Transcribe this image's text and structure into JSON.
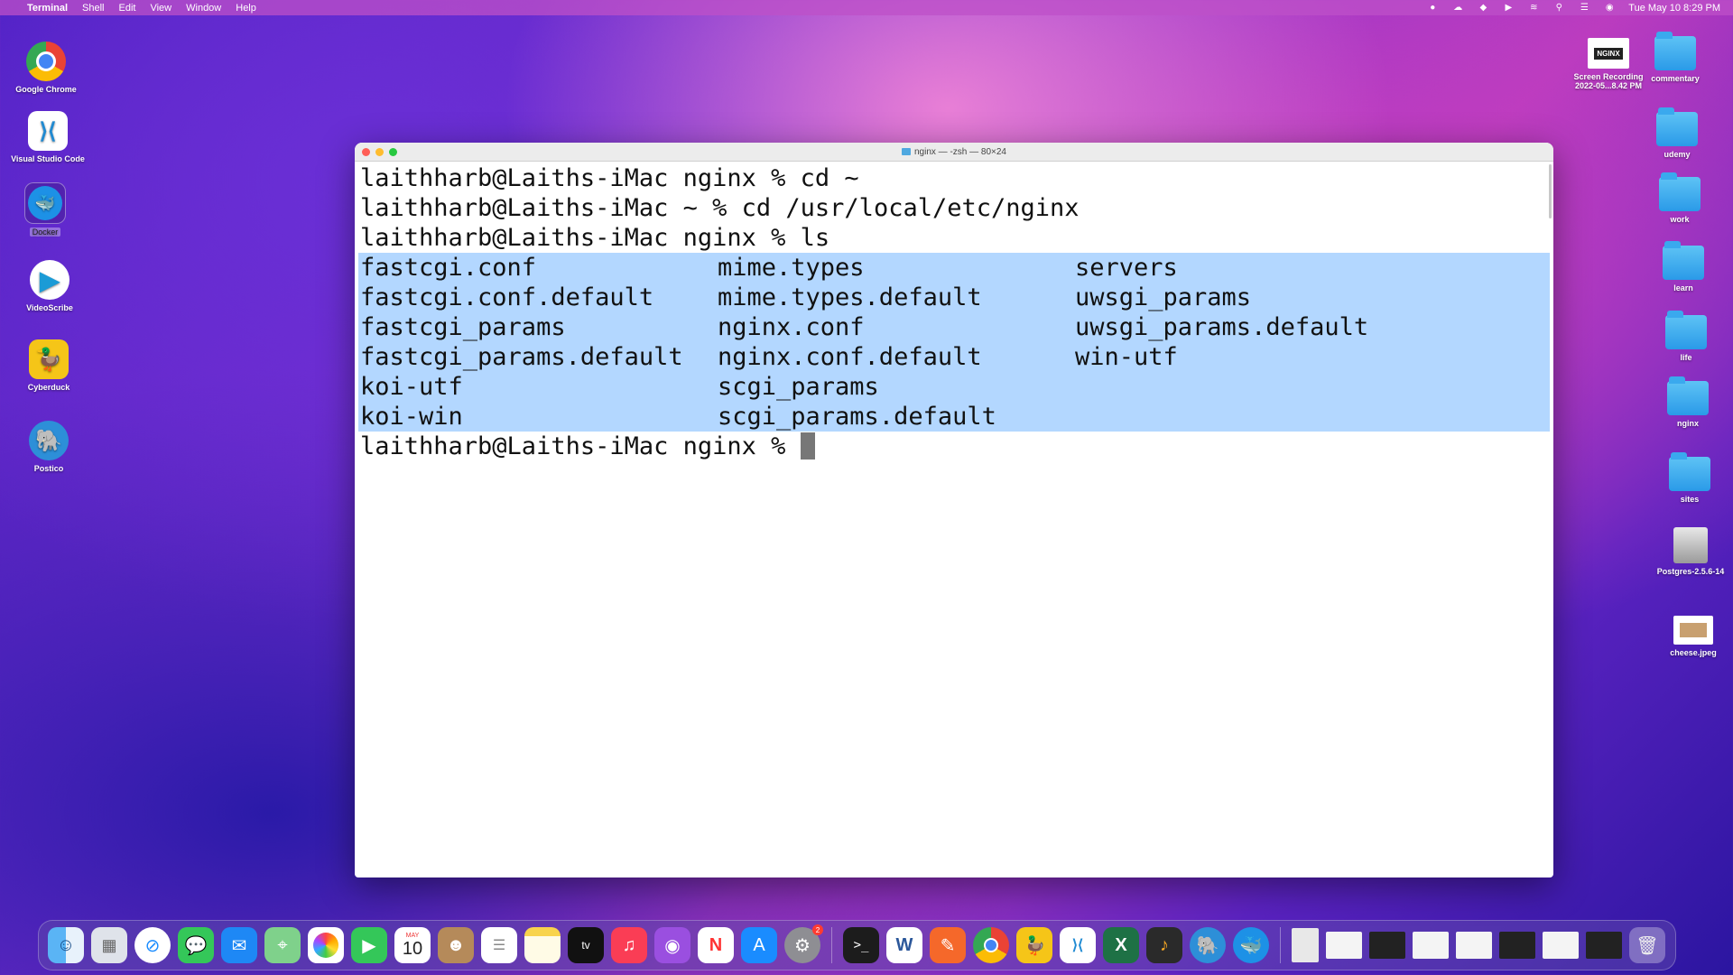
{
  "menubar": {
    "apple": "",
    "items": [
      "Terminal",
      "Shell",
      "Edit",
      "View",
      "Window",
      "Help"
    ],
    "datetime": "Tue May 10  8:29 PM"
  },
  "desktop_left": [
    {
      "label": "Google Chrome",
      "icon": "chrome-icon"
    },
    {
      "label": "Visual Studio Code",
      "icon": "vscode-icon"
    },
    {
      "label": "Docker",
      "icon": "docker-icon"
    },
    {
      "label": "VideoScribe",
      "icon": "videoscribe-icon"
    },
    {
      "label": "Cyberduck",
      "icon": "cyberduck-icon"
    },
    {
      "label": "Postico",
      "icon": "postico-icon"
    }
  ],
  "desktop_right": [
    {
      "label": "Screen Recording 2022-05...8.42 PM",
      "thumb_text": "NGINX"
    },
    {
      "label": "commentary"
    },
    {
      "label": "udemy"
    },
    {
      "label": "work"
    },
    {
      "label": "learn"
    },
    {
      "label": "life"
    },
    {
      "label": "nginx"
    },
    {
      "label": "sites"
    },
    {
      "label": "Postgres-2.5.6-14"
    },
    {
      "label": "cheese.jpeg"
    }
  ],
  "terminal": {
    "title": "nginx — -zsh — 80×24",
    "commands": [
      "laithharb@Laiths-iMac nginx % cd ~",
      "laithharb@Laiths-iMac ~ % cd /usr/local/etc/nginx",
      "laithharb@Laiths-iMac nginx % ls"
    ],
    "listing": [
      [
        "fastcgi.conf",
        "mime.types",
        "servers"
      ],
      [
        "fastcgi.conf.default",
        "mime.types.default",
        "uwsgi_params"
      ],
      [
        "fastcgi_params",
        "nginx.conf",
        "uwsgi_params.default"
      ],
      [
        "fastcgi_params.default",
        "nginx.conf.default",
        "win-utf"
      ],
      [
        "koi-utf",
        "scgi_params",
        ""
      ],
      [
        "koi-win",
        "scgi_params.default",
        ""
      ]
    ],
    "prompt": "laithharb@Laiths-iMac nginx % "
  },
  "dock": {
    "calendar_month": "MAY",
    "calendar_day": "10",
    "system_prefs_badge": "2",
    "apps": [
      "Finder",
      "Launchpad",
      "Safari",
      "Messages",
      "Mail",
      "Maps",
      "Photos",
      "FaceTime",
      "Calendar",
      "Contacts",
      "Reminders",
      "Notes",
      "TV",
      "Music",
      "Podcasts",
      "News",
      "App Store",
      "System Preferences",
      "Terminal",
      "Word",
      "Sketch",
      "Chrome",
      "Cyberduck",
      "VS Code",
      "Excel",
      "GarageBand",
      "Postico",
      "Docker"
    ]
  }
}
